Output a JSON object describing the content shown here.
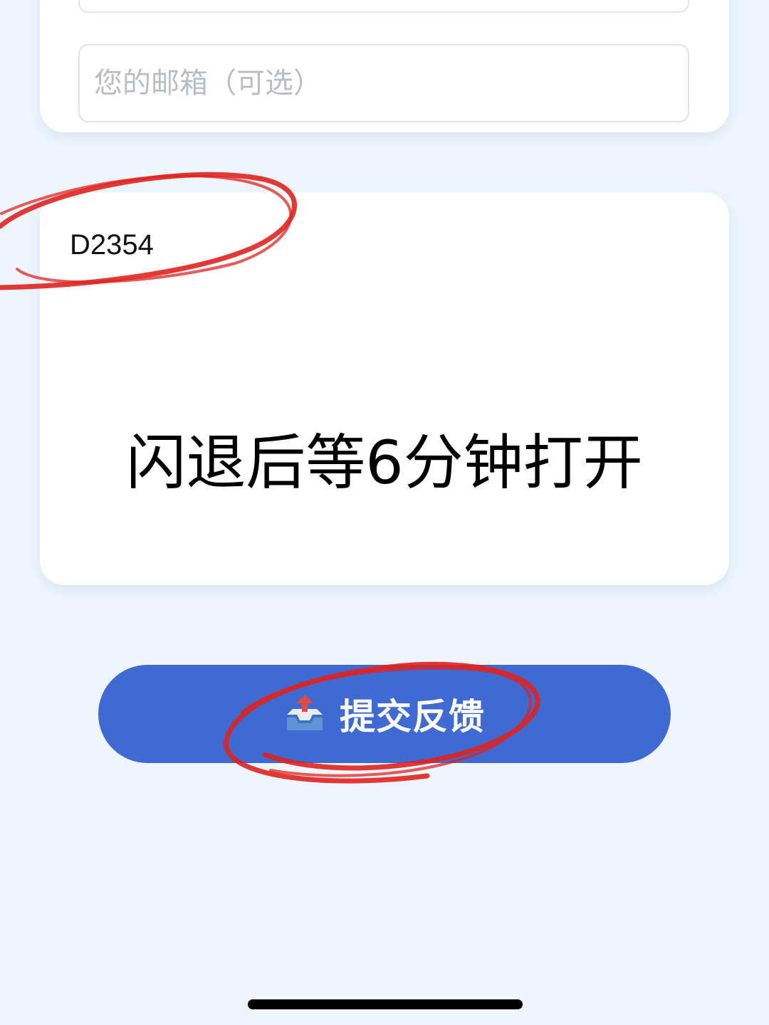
{
  "form": {
    "email_placeholder": "您的邮箱（可选）"
  },
  "content_card": {
    "code": "D2354",
    "message": "闪退后等6分钟打开"
  },
  "submit": {
    "icon": "outbox-tray-icon",
    "label": "提交反馈"
  },
  "colors": {
    "background": "#eef5fd",
    "card": "#ffffff",
    "button": "#3f69d3",
    "annotation": "#e0231f"
  }
}
